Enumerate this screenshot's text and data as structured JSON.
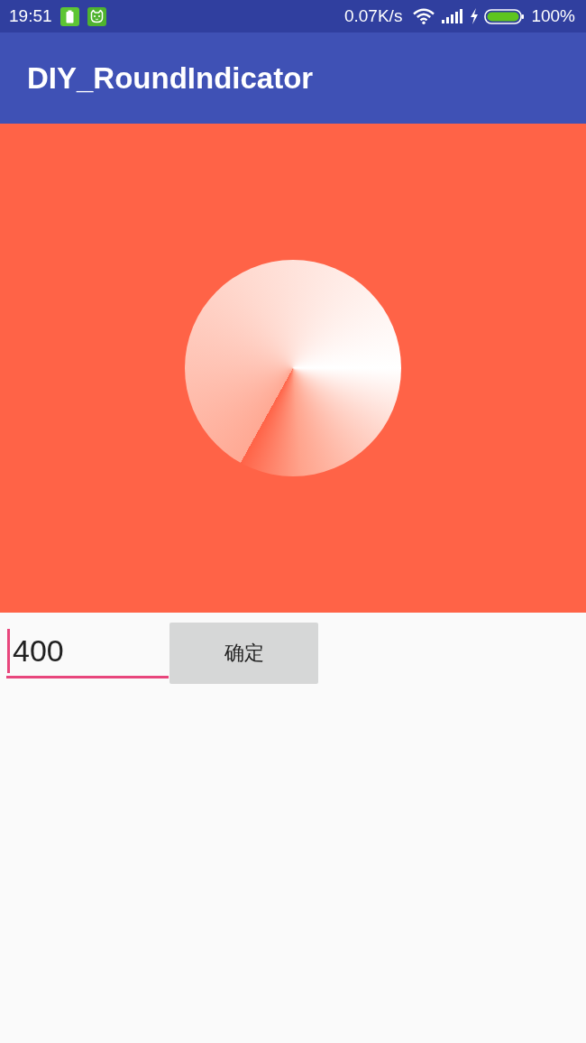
{
  "status_bar": {
    "time": "19:51",
    "net_speed": "0.07K/s",
    "battery_percent": "100%"
  },
  "app_bar": {
    "title": "DIY_RoundIndicator"
  },
  "input": {
    "value": "400",
    "focused": true
  },
  "confirm_button": {
    "label": "确定"
  }
}
